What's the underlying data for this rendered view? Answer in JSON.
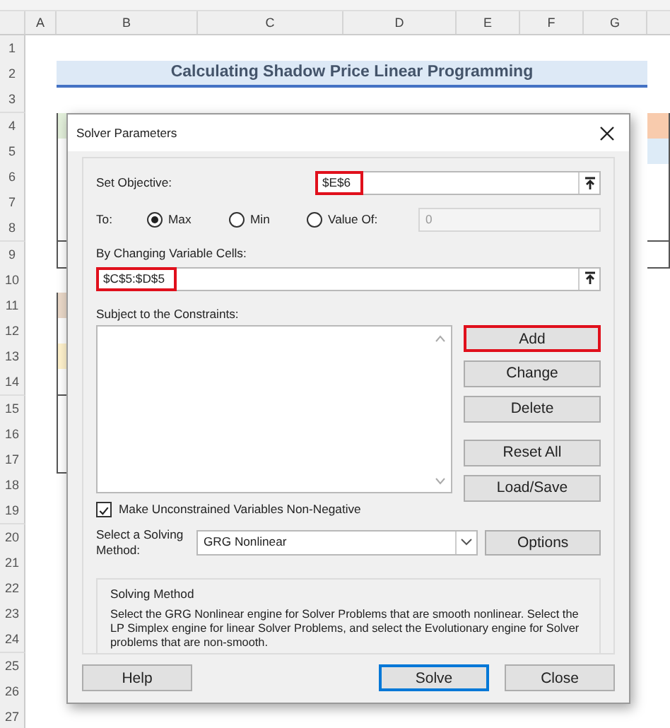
{
  "spreadsheet": {
    "columns": [
      "A",
      "B",
      "C",
      "D",
      "E",
      "F",
      "G"
    ],
    "rows": [
      "1",
      "2",
      "3",
      "4",
      "5",
      "6",
      "7",
      "8",
      "9",
      "10",
      "11",
      "12",
      "13",
      "14",
      "15",
      "16",
      "17",
      "18",
      "19",
      "20",
      "21",
      "22",
      "23",
      "24",
      "25",
      "26",
      "27"
    ],
    "title": "Calculating Shadow Price Linear Programming"
  },
  "dialog": {
    "title": "Solver Parameters",
    "objective": {
      "label": "Set Objective:",
      "value": "$E$6",
      "highlighted": true
    },
    "to": {
      "label": "To:",
      "options": [
        {
          "label": "Max",
          "selected": true
        },
        {
          "label": "Min",
          "selected": false
        },
        {
          "label": "Value Of:",
          "selected": false
        }
      ],
      "value": "0",
      "disabled": true
    },
    "variables": {
      "label": "By Changing Variable Cells:",
      "value": "$C$5:$D$5",
      "highlighted": true
    },
    "constraints": {
      "label": "Subject to the Constraints:"
    },
    "constraint_buttons": [
      [
        {
          "label": "Add",
          "highlighted": true
        },
        {
          "label": "Change",
          "highlighted": false
        },
        {
          "label": "Delete",
          "highlighted": false
        }
      ],
      [
        {
          "label": "Reset All",
          "highlighted": false
        },
        {
          "label": "Load/Save",
          "highlighted": false
        }
      ]
    ],
    "nonnegative": {
      "label": "Make Unconstrained Variables Non-Negative",
      "checked": true
    },
    "method": {
      "label": "Select a Solving Method:",
      "value": "GRG Nonlinear",
      "options_button": "Options"
    },
    "method_info": {
      "title": "Solving Method",
      "text": "Select the GRG Nonlinear engine for Solver Problems that are smooth nonlinear. Select the LP Simplex engine for linear Solver Problems, and select the Evolutionary engine for Solver problems that are non-smooth."
    },
    "buttons": [
      {
        "label": "Help",
        "focused": false
      },
      {
        "label": "Solve",
        "focused": true
      },
      {
        "label": "Close",
        "focused": false
      }
    ]
  }
}
